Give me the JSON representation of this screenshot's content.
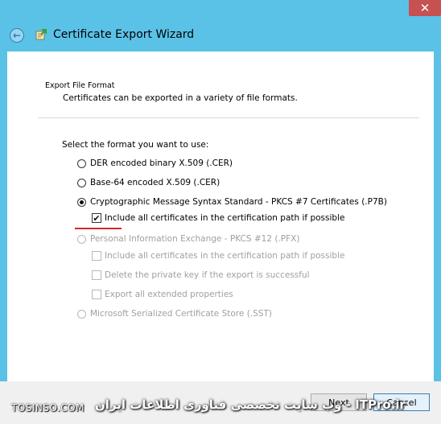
{
  "window": {
    "title": "Certificate Export Wizard",
    "close_glyph": "✕",
    "back_glyph": "←"
  },
  "section": {
    "title": "Export File Format",
    "description": "Certificates can be exported in a variety of file formats."
  },
  "prompt": "Select the format you want to use:",
  "options": {
    "der": {
      "label": "DER encoded binary X.509 (.CER)",
      "selected": false,
      "enabled": true
    },
    "base64": {
      "label": "Base-64 encoded X.509 (.CER)",
      "selected": false,
      "enabled": true
    },
    "pkcs7": {
      "label": "Cryptographic Message Syntax Standard - PKCS #7 Certificates (.P7B)",
      "selected": true,
      "enabled": true
    },
    "pkcs7_include_all": {
      "label": "Include all certificates in the certification path if possible",
      "checked": true,
      "enabled": true
    },
    "pfx": {
      "label": "Personal Information Exchange - PKCS #12 (.PFX)",
      "selected": false,
      "enabled": false
    },
    "pfx_include_all": {
      "label": "Include all certificates in the certification path if possible",
      "checked": false,
      "enabled": false
    },
    "pfx_delete_key": {
      "label": "Delete the private key if the export is successful",
      "checked": false,
      "enabled": false
    },
    "pfx_export_props": {
      "label": "Export all extended properties",
      "checked": false,
      "enabled": false
    },
    "sst": {
      "label": "Microsoft Serialized Certificate Store (.SST)",
      "selected": false,
      "enabled": false
    }
  },
  "footer": {
    "next_label": "Next",
    "cancel_label": "Cancel"
  },
  "watermark": {
    "left": "TOSINSO.COM",
    "right": "ITPro.ir - وب سایت تخصصی فناوری اطلاعات ایران"
  },
  "colors": {
    "frame": "#5bc2e7",
    "close": "#c75050",
    "annotation": "#d62828"
  }
}
